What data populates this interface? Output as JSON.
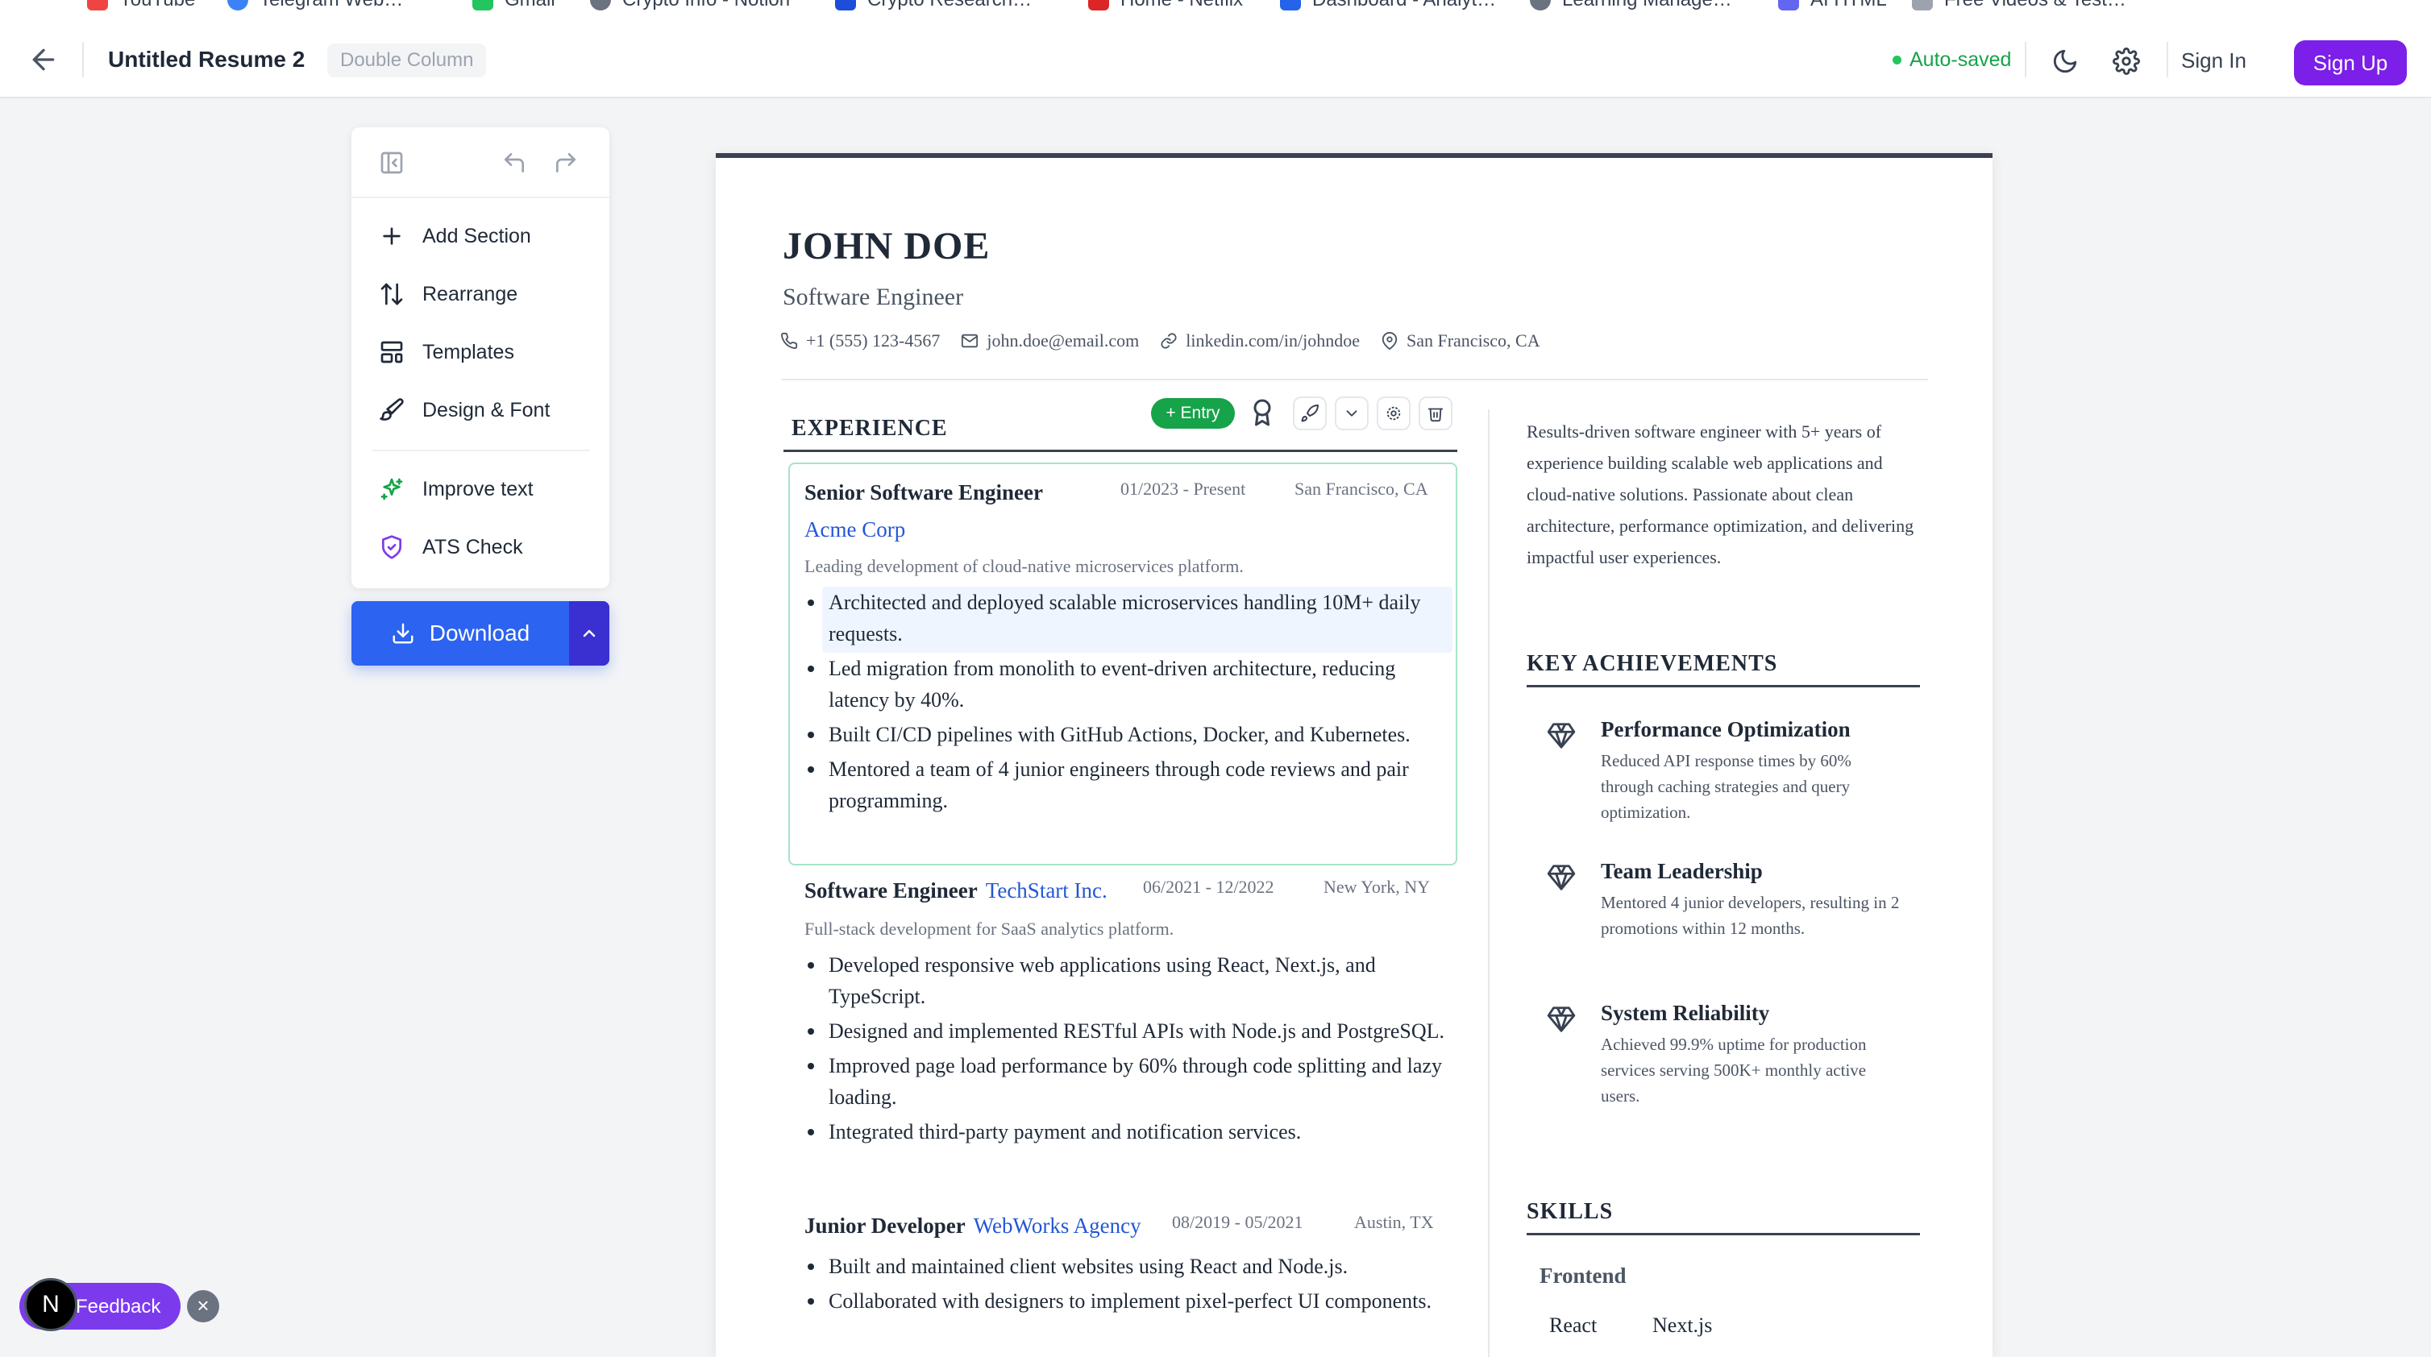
{
  "bookmarks": [
    {
      "label": "YouTube",
      "color": "#ef4444"
    },
    {
      "label": "Telegram Web…",
      "color": "#3b82f6"
    },
    {
      "label": "Gmail",
      "color": "#22c55e"
    },
    {
      "label": "Crypto Info - Notion",
      "color": "#6b7280"
    },
    {
      "label": "Crypto Research…",
      "color": "#1d4ed8"
    },
    {
      "label": "Home - Netflix",
      "color": "#dc2626"
    },
    {
      "label": "Dashboard - Analyt…",
      "color": "#2563eb"
    },
    {
      "label": "Learning Manage…",
      "color": "#6b7280"
    },
    {
      "label": "AI HTML",
      "color": "#6366f1"
    },
    {
      "label": "Free Videos & Test…",
      "color": "#9ca3af"
    }
  ],
  "header": {
    "title": "Untitled Resume 2",
    "layout_badge": "Double Column",
    "status": "Auto-saved",
    "status_color": "#16a34a",
    "signin": "Sign In",
    "signup": "Sign Up",
    "accent": "#7c1fe8"
  },
  "tools": {
    "add_section": "Add Section",
    "rearrange": "Rearrange",
    "templates": "Templates",
    "design_font": "Design & Font",
    "improve_text": "Improve text",
    "ats_check": "ATS Check",
    "download": "Download"
  },
  "resume": {
    "name": "JOHN DOE",
    "role": "Software Engineer",
    "phone": "+1 (555) 123-4567",
    "email": "john.doe@email.com",
    "linkedin": "linkedin.com/in/johndoe",
    "location": "San Francisco, CA",
    "experience_title": "EXPERIENCE",
    "entry_button": "+ Entry",
    "jobs": [
      {
        "title": "Senior Software Engineer",
        "company": "Acme Corp",
        "dates": "01/2023 - Present",
        "location": "San Francisco, CA",
        "description": "Leading development of cloud-native microservices platform.",
        "bullets": [
          "Architected and deployed scalable microservices handling 10M+ daily requests.",
          "Led migration from monolith to event-driven architecture, reducing latency by 40%.",
          "Built CI/CD pipelines with GitHub Actions, Docker, and Kubernetes.",
          "Mentored a team of 4 junior engineers through code reviews and pair programming."
        ]
      },
      {
        "title": "Software Engineer",
        "company": "TechStart Inc.",
        "dates": "06/2021 - 12/2022",
        "location": "New York, NY",
        "description": "Full-stack development for SaaS analytics platform.",
        "bullets": [
          "Developed responsive web applications using React, Next.js, and TypeScript.",
          "Designed and implemented RESTful APIs with Node.js and PostgreSQL.",
          "Improved page load performance by 60% through code splitting and lazy loading.",
          "Integrated third-party payment and notification services."
        ]
      },
      {
        "title": "Junior Developer",
        "company": "WebWorks Agency",
        "dates": "08/2019 - 05/2021",
        "location": "Austin, TX",
        "bullets": [
          "Built and maintained client websites using React and Node.js.",
          "Collaborated with designers to implement pixel-perfect UI components."
        ]
      }
    ],
    "summary": "Results-driven software engineer with 5+ years of experience building scalable web applications and cloud-native solutions. Passionate about clean architecture, performance optimization, and delivering impactful user experiences.",
    "achievements_title": "KEY ACHIEVEMENTS",
    "achievements": [
      {
        "title": "Performance Optimization",
        "text": "Reduced API response times by 60% through caching strategies and query optimization."
      },
      {
        "title": "Team Leadership",
        "text": "Mentored 4 junior developers, resulting in 2 promotions within 12 months."
      },
      {
        "title": "System Reliability",
        "text": "Achieved 99.9% uptime for production services serving 500K+ monthly active users."
      }
    ],
    "skills_title": "SKILLS",
    "skills": {
      "category": "Frontend",
      "items": [
        "React",
        "Next.js"
      ]
    }
  },
  "feedback": {
    "label": "Feedback",
    "badge": "N",
    "close": "×"
  }
}
